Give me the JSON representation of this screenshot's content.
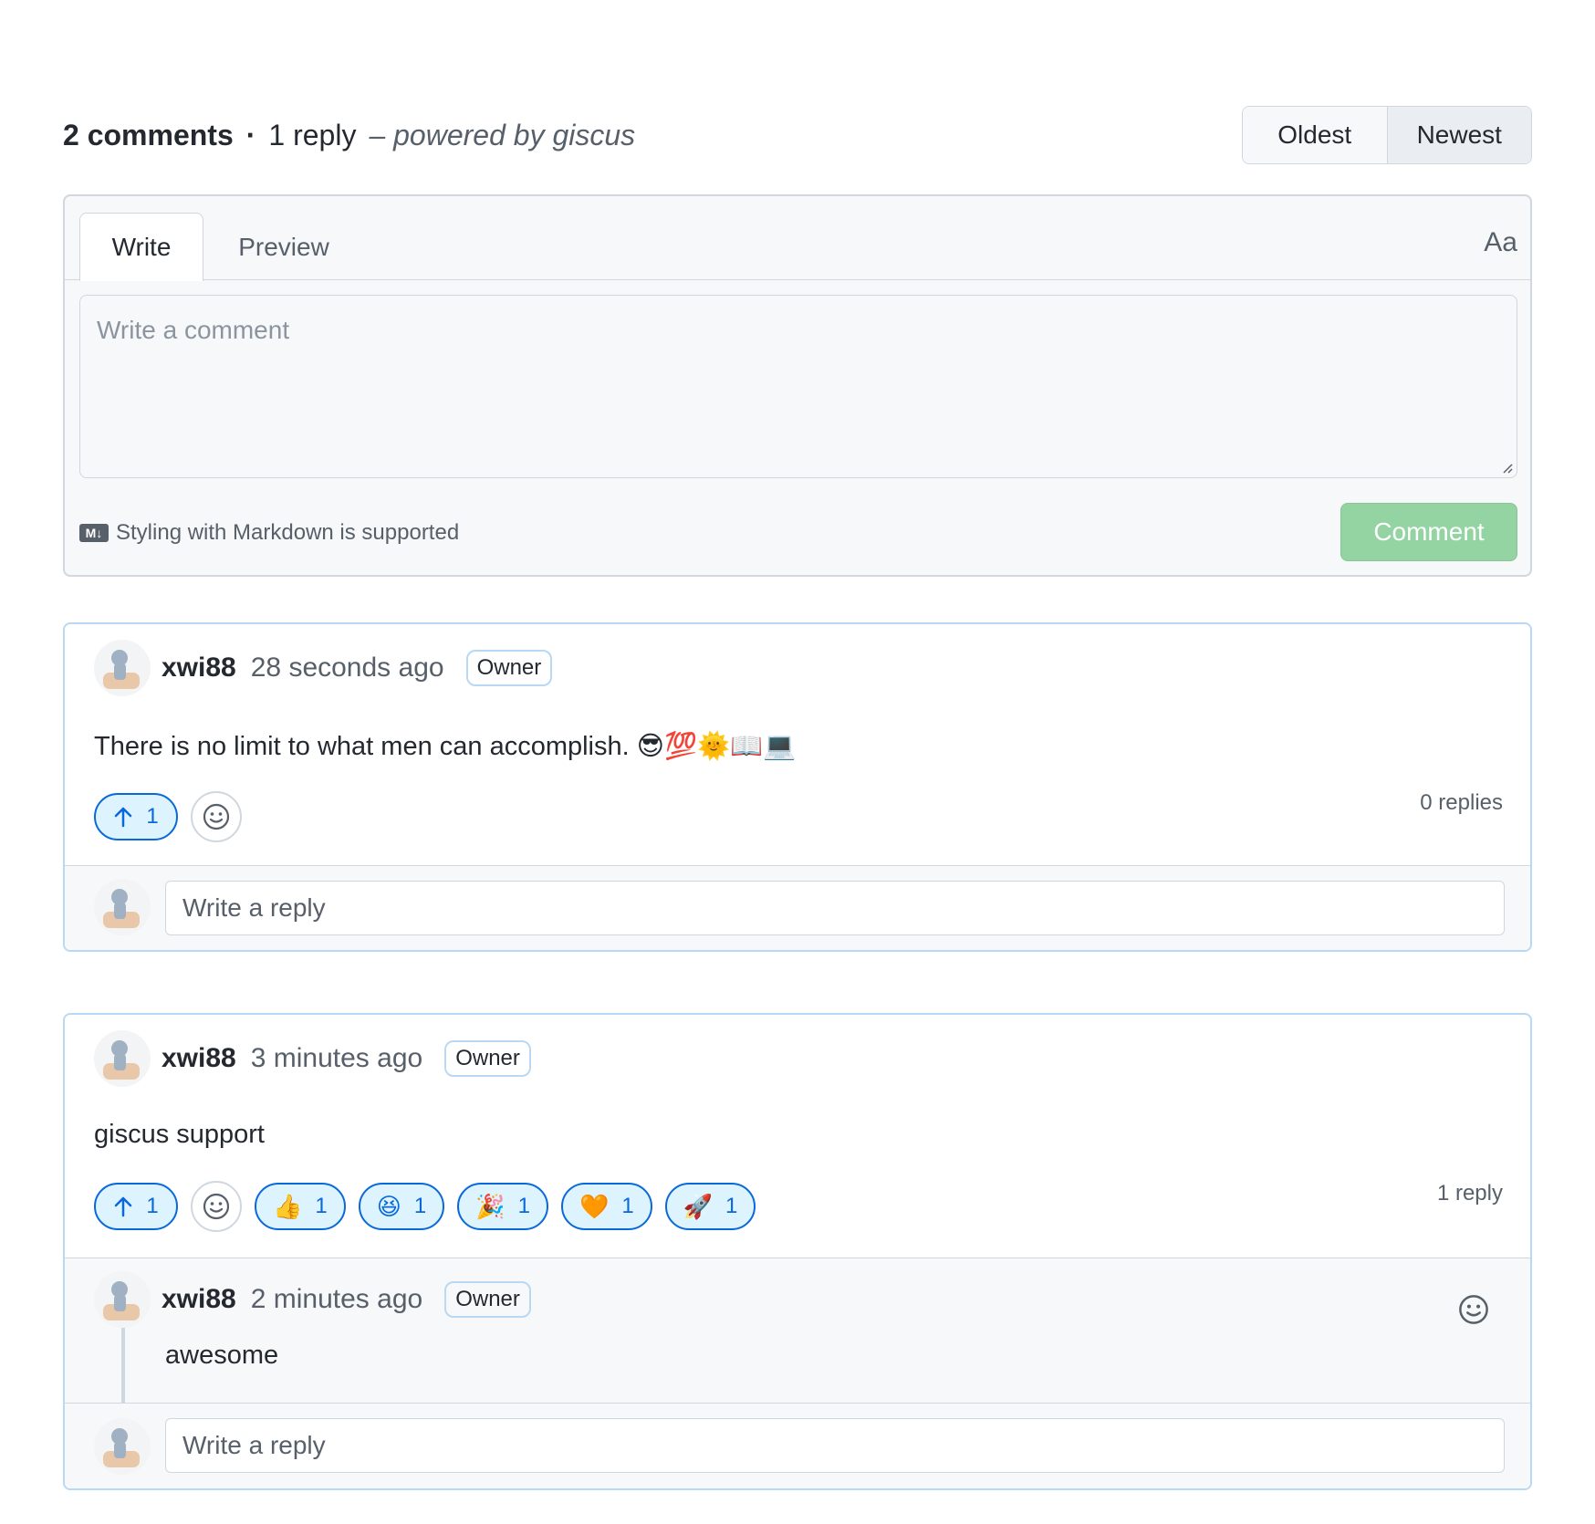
{
  "header": {
    "comments_count": "2 comments",
    "separator": "·",
    "replies_count": "1 reply",
    "powered_by": "– powered by giscus",
    "sort": {
      "oldest": "Oldest",
      "newest": "Newest",
      "selected": "Newest"
    }
  },
  "editor": {
    "tab_write": "Write",
    "tab_preview": "Preview",
    "format_toggle": "Aa",
    "placeholder": "Write a comment",
    "markdown_note": "Styling with Markdown is supported",
    "markdown_icon": "M↓",
    "submit_label": "Comment"
  },
  "comments": [
    {
      "author": "xwi88",
      "time": "28 seconds ago",
      "badge": "Owner",
      "body": "There is no limit to what men can accomplish. 😎💯🌞📖💻",
      "upvotes": "1",
      "reactions": [],
      "replies_label": "0 replies",
      "reply_placeholder": "Write a reply",
      "replies": []
    },
    {
      "author": "xwi88",
      "time": "3 minutes ago",
      "badge": "Owner",
      "body": "giscus support",
      "upvotes": "1",
      "reactions": [
        {
          "emoji": "👍",
          "count": "1"
        },
        {
          "emoji": "😆",
          "count": "1"
        },
        {
          "emoji": "🎉",
          "count": "1"
        },
        {
          "emoji": "🧡",
          "count": "1"
        },
        {
          "emoji": "🚀",
          "count": "1"
        }
      ],
      "replies_label": "1 reply",
      "reply_placeholder": "Write a reply",
      "replies": [
        {
          "author": "xwi88",
          "time": "2 minutes ago",
          "badge": "Owner",
          "body": "awesome"
        }
      ]
    }
  ],
  "colors": {
    "accent": "#0969da",
    "accent_bg": "#ddf4ff",
    "card_border": "#b9d8f3",
    "comment_button": "#94d3a2",
    "border": "#d0d7de"
  }
}
